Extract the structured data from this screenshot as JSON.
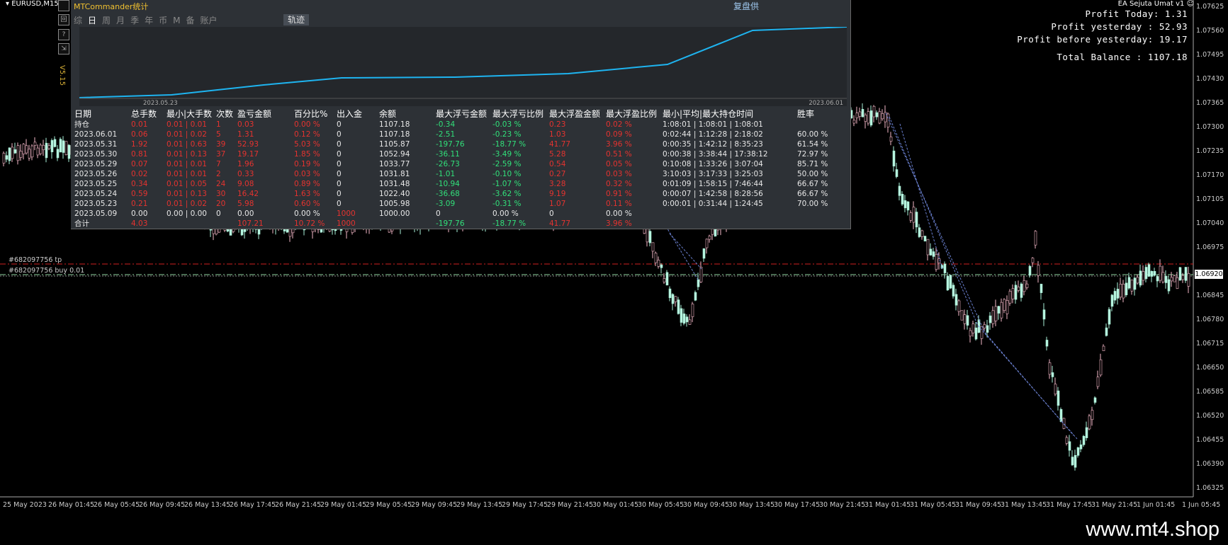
{
  "symbol": "EURUSD,M15",
  "version": "V5.15",
  "buttons": [
    "回",
    "?",
    "⇲"
  ],
  "ea_name": "EA Sejuta Umat v1",
  "profit": {
    "today": "Profit Today: 1.31",
    "yesterday": "Profit yesterday : 52.93",
    "before_yesterday": "Profit before yesterday: 19.17",
    "total_balance": "Total Balance : 1107.18"
  },
  "panel": {
    "title": "MTCommander统计",
    "review": "复盘供",
    "tabs": [
      "综",
      "日",
      "周",
      "月",
      "季",
      "年",
      "币",
      "M",
      "备",
      "账户"
    ],
    "active_tab": "日",
    "track_tab": "轨迹",
    "chart_start_date": "2023.05.23",
    "chart_end_date": "2023.06.01"
  },
  "table": {
    "headers": [
      "日期",
      "总手数",
      "最小|大手数",
      "次数",
      "盈亏金额",
      "百分比%",
      "出入金",
      "余额",
      "最大浮亏金额",
      "最大浮亏比例",
      "最大浮盈金额",
      "最大浮盈比例",
      "最小|平均|最大持仓时间",
      "胜率"
    ],
    "rows": [
      [
        "持仓",
        "0.01",
        "0.01 | 0.01",
        "1",
        "0.03",
        "0.00 %",
        "0",
        "1107.18",
        "-0.34",
        "-0.03 %",
        "0.23",
        "0.02 %",
        "1:08:01 | 1:08:01 | 1:08:01",
        ""
      ],
      [
        "2023.06.01",
        "0.06",
        "0.01 | 0.02",
        "5",
        "1.31",
        "0.12 %",
        "0",
        "1107.18",
        "-2.51",
        "-0.23 %",
        "1.03",
        "0.09 %",
        "0:02:44 | 1:12:28 | 2:18:02",
        "60.00 %"
      ],
      [
        "2023.05.31",
        "1.92",
        "0.01 | 0.63",
        "39",
        "52.93",
        "5.03 %",
        "0",
        "1105.87",
        "-197.76",
        "-18.77 %",
        "41.77",
        "3.96 %",
        "0:00:35 | 1:42:12 | 8:35:23",
        "61.54 %"
      ],
      [
        "2023.05.30",
        "0.81",
        "0.01 | 0.13",
        "37",
        "19.17",
        "1.85 %",
        "0",
        "1052.94",
        "-36.11",
        "-3.49 %",
        "5.28",
        "0.51 %",
        "0:00:38 | 3:38:44 | 17:38:12",
        "72.97 %"
      ],
      [
        "2023.05.29",
        "0.07",
        "0.01 | 0.01",
        "7",
        "1.96",
        "0.19 %",
        "0",
        "1033.77",
        "-26.73",
        "-2.59 %",
        "0.54",
        "0.05 %",
        "0:10:08 | 1:33:26 | 3:07:04",
        "85.71 %"
      ],
      [
        "2023.05.26",
        "0.02",
        "0.01 | 0.01",
        "2",
        "0.33",
        "0.03 %",
        "0",
        "1031.81",
        "-1.01",
        "-0.10 %",
        "0.27",
        "0.03 %",
        "3:10:03 | 3:17:33 | 3:25:03",
        "50.00 %"
      ],
      [
        "2023.05.25",
        "0.34",
        "0.01 | 0.05",
        "24",
        "9.08",
        "0.89 %",
        "0",
        "1031.48",
        "-10.94",
        "-1.07 %",
        "3.28",
        "0.32 %",
        "0:01:09 | 1:58:15 | 7:46:44",
        "66.67 %"
      ],
      [
        "2023.05.24",
        "0.59",
        "0.01 | 0.13",
        "30",
        "16.42",
        "1.63 %",
        "0",
        "1022.40",
        "-36.68",
        "-3.62 %",
        "9.19",
        "0.91 %",
        "0:00:07 | 1:42:58 | 8:28:56",
        "66.67 %"
      ],
      [
        "2023.05.23",
        "0.21",
        "0.01 | 0.02",
        "20",
        "5.98",
        "0.60 %",
        "0",
        "1005.98",
        "-3.09",
        "-0.31 %",
        "1.07",
        "0.11 %",
        "0:00:01 | 0:31:44 | 1:24:45",
        "70.00 %"
      ],
      [
        "2023.05.09",
        "0.00",
        "0.00 | 0.00",
        "0",
        "0.00",
        "0.00 %",
        "1000",
        "1000.00",
        "0",
        "0.00 %",
        "0",
        "0.00 %",
        "",
        ""
      ]
    ],
    "total": [
      "合计",
      "4.03",
      "",
      "",
      "107.21",
      "10.72 %",
      "1000",
      "",
      "-197.76",
      "-18.77 %",
      "41.77",
      "3.96 %",
      "",
      ""
    ]
  },
  "price_axis": [
    "1.07625",
    "1.07560",
    "1.07495",
    "1.07430",
    "1.07365",
    "1.07300",
    "1.07235",
    "1.07170",
    "1.07105",
    "1.07040",
    "1.06975",
    "1.06845",
    "1.06780",
    "1.06715",
    "1.06650",
    "1.06585",
    "1.06520",
    "1.06455",
    "1.06390",
    "1.06325"
  ],
  "current_price": "1.06920",
  "time_axis": [
    "25 May 2023",
    "26 May 01:45",
    "26 May 05:45",
    "26 May 09:45",
    "26 May 13:45",
    "26 May 17:45",
    "26 May 21:45",
    "29 May 01:45",
    "29 May 05:45",
    "29 May 09:45",
    "29 May 13:45",
    "29 May 17:45",
    "29 May 21:45",
    "30 May 01:45",
    "30 May 05:45",
    "30 May 09:45",
    "30 May 13:45",
    "30 May 17:45",
    "30 May 21:45",
    "31 May 01:45",
    "31 May 05:45",
    "31 May 09:45",
    "31 May 13:45",
    "31 May 17:45",
    "31 May 21:45",
    "1 Jun 01:45",
    "1 Jun 05:45"
  ],
  "orders": {
    "tp_label": "#682097756 tp",
    "buy_label": "#682097756 buy 0.01"
  },
  "watermark": "www.mt4.shop"
}
